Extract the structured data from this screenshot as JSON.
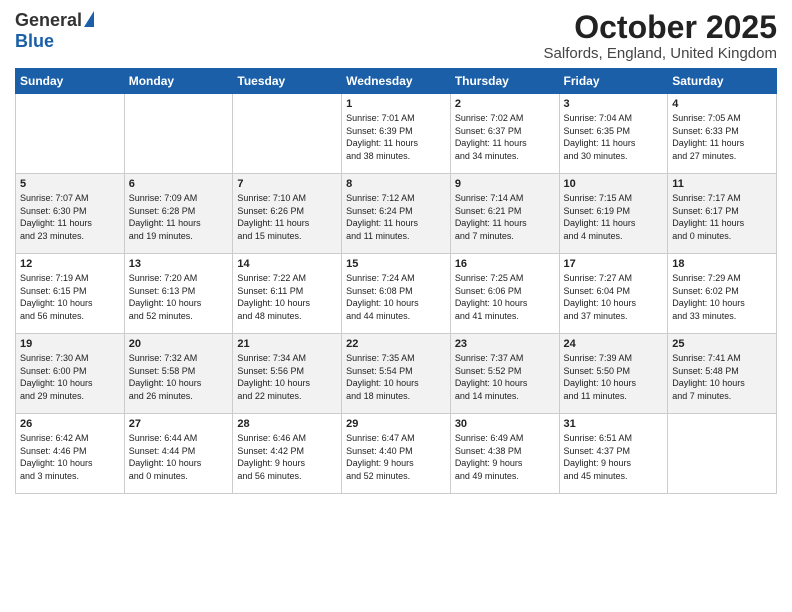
{
  "header": {
    "logo_general": "General",
    "logo_blue": "Blue",
    "month": "October 2025",
    "location": "Salfords, England, United Kingdom"
  },
  "days_of_week": [
    "Sunday",
    "Monday",
    "Tuesday",
    "Wednesday",
    "Thursday",
    "Friday",
    "Saturday"
  ],
  "weeks": [
    [
      {
        "day": "",
        "info": ""
      },
      {
        "day": "",
        "info": ""
      },
      {
        "day": "",
        "info": ""
      },
      {
        "day": "1",
        "info": "Sunrise: 7:01 AM\nSunset: 6:39 PM\nDaylight: 11 hours\nand 38 minutes."
      },
      {
        "day": "2",
        "info": "Sunrise: 7:02 AM\nSunset: 6:37 PM\nDaylight: 11 hours\nand 34 minutes."
      },
      {
        "day": "3",
        "info": "Sunrise: 7:04 AM\nSunset: 6:35 PM\nDaylight: 11 hours\nand 30 minutes."
      },
      {
        "day": "4",
        "info": "Sunrise: 7:05 AM\nSunset: 6:33 PM\nDaylight: 11 hours\nand 27 minutes."
      }
    ],
    [
      {
        "day": "5",
        "info": "Sunrise: 7:07 AM\nSunset: 6:30 PM\nDaylight: 11 hours\nand 23 minutes."
      },
      {
        "day": "6",
        "info": "Sunrise: 7:09 AM\nSunset: 6:28 PM\nDaylight: 11 hours\nand 19 minutes."
      },
      {
        "day": "7",
        "info": "Sunrise: 7:10 AM\nSunset: 6:26 PM\nDaylight: 11 hours\nand 15 minutes."
      },
      {
        "day": "8",
        "info": "Sunrise: 7:12 AM\nSunset: 6:24 PM\nDaylight: 11 hours\nand 11 minutes."
      },
      {
        "day": "9",
        "info": "Sunrise: 7:14 AM\nSunset: 6:21 PM\nDaylight: 11 hours\nand 7 minutes."
      },
      {
        "day": "10",
        "info": "Sunrise: 7:15 AM\nSunset: 6:19 PM\nDaylight: 11 hours\nand 4 minutes."
      },
      {
        "day": "11",
        "info": "Sunrise: 7:17 AM\nSunset: 6:17 PM\nDaylight: 11 hours\nand 0 minutes."
      }
    ],
    [
      {
        "day": "12",
        "info": "Sunrise: 7:19 AM\nSunset: 6:15 PM\nDaylight: 10 hours\nand 56 minutes."
      },
      {
        "day": "13",
        "info": "Sunrise: 7:20 AM\nSunset: 6:13 PM\nDaylight: 10 hours\nand 52 minutes."
      },
      {
        "day": "14",
        "info": "Sunrise: 7:22 AM\nSunset: 6:11 PM\nDaylight: 10 hours\nand 48 minutes."
      },
      {
        "day": "15",
        "info": "Sunrise: 7:24 AM\nSunset: 6:08 PM\nDaylight: 10 hours\nand 44 minutes."
      },
      {
        "day": "16",
        "info": "Sunrise: 7:25 AM\nSunset: 6:06 PM\nDaylight: 10 hours\nand 41 minutes."
      },
      {
        "day": "17",
        "info": "Sunrise: 7:27 AM\nSunset: 6:04 PM\nDaylight: 10 hours\nand 37 minutes."
      },
      {
        "day": "18",
        "info": "Sunrise: 7:29 AM\nSunset: 6:02 PM\nDaylight: 10 hours\nand 33 minutes."
      }
    ],
    [
      {
        "day": "19",
        "info": "Sunrise: 7:30 AM\nSunset: 6:00 PM\nDaylight: 10 hours\nand 29 minutes."
      },
      {
        "day": "20",
        "info": "Sunrise: 7:32 AM\nSunset: 5:58 PM\nDaylight: 10 hours\nand 26 minutes."
      },
      {
        "day": "21",
        "info": "Sunrise: 7:34 AM\nSunset: 5:56 PM\nDaylight: 10 hours\nand 22 minutes."
      },
      {
        "day": "22",
        "info": "Sunrise: 7:35 AM\nSunset: 5:54 PM\nDaylight: 10 hours\nand 18 minutes."
      },
      {
        "day": "23",
        "info": "Sunrise: 7:37 AM\nSunset: 5:52 PM\nDaylight: 10 hours\nand 14 minutes."
      },
      {
        "day": "24",
        "info": "Sunrise: 7:39 AM\nSunset: 5:50 PM\nDaylight: 10 hours\nand 11 minutes."
      },
      {
        "day": "25",
        "info": "Sunrise: 7:41 AM\nSunset: 5:48 PM\nDaylight: 10 hours\nand 7 minutes."
      }
    ],
    [
      {
        "day": "26",
        "info": "Sunrise: 6:42 AM\nSunset: 4:46 PM\nDaylight: 10 hours\nand 3 minutes."
      },
      {
        "day": "27",
        "info": "Sunrise: 6:44 AM\nSunset: 4:44 PM\nDaylight: 10 hours\nand 0 minutes."
      },
      {
        "day": "28",
        "info": "Sunrise: 6:46 AM\nSunset: 4:42 PM\nDaylight: 9 hours\nand 56 minutes."
      },
      {
        "day": "29",
        "info": "Sunrise: 6:47 AM\nSunset: 4:40 PM\nDaylight: 9 hours\nand 52 minutes."
      },
      {
        "day": "30",
        "info": "Sunrise: 6:49 AM\nSunset: 4:38 PM\nDaylight: 9 hours\nand 49 minutes."
      },
      {
        "day": "31",
        "info": "Sunrise: 6:51 AM\nSunset: 4:37 PM\nDaylight: 9 hours\nand 45 minutes."
      },
      {
        "day": "",
        "info": ""
      }
    ]
  ]
}
